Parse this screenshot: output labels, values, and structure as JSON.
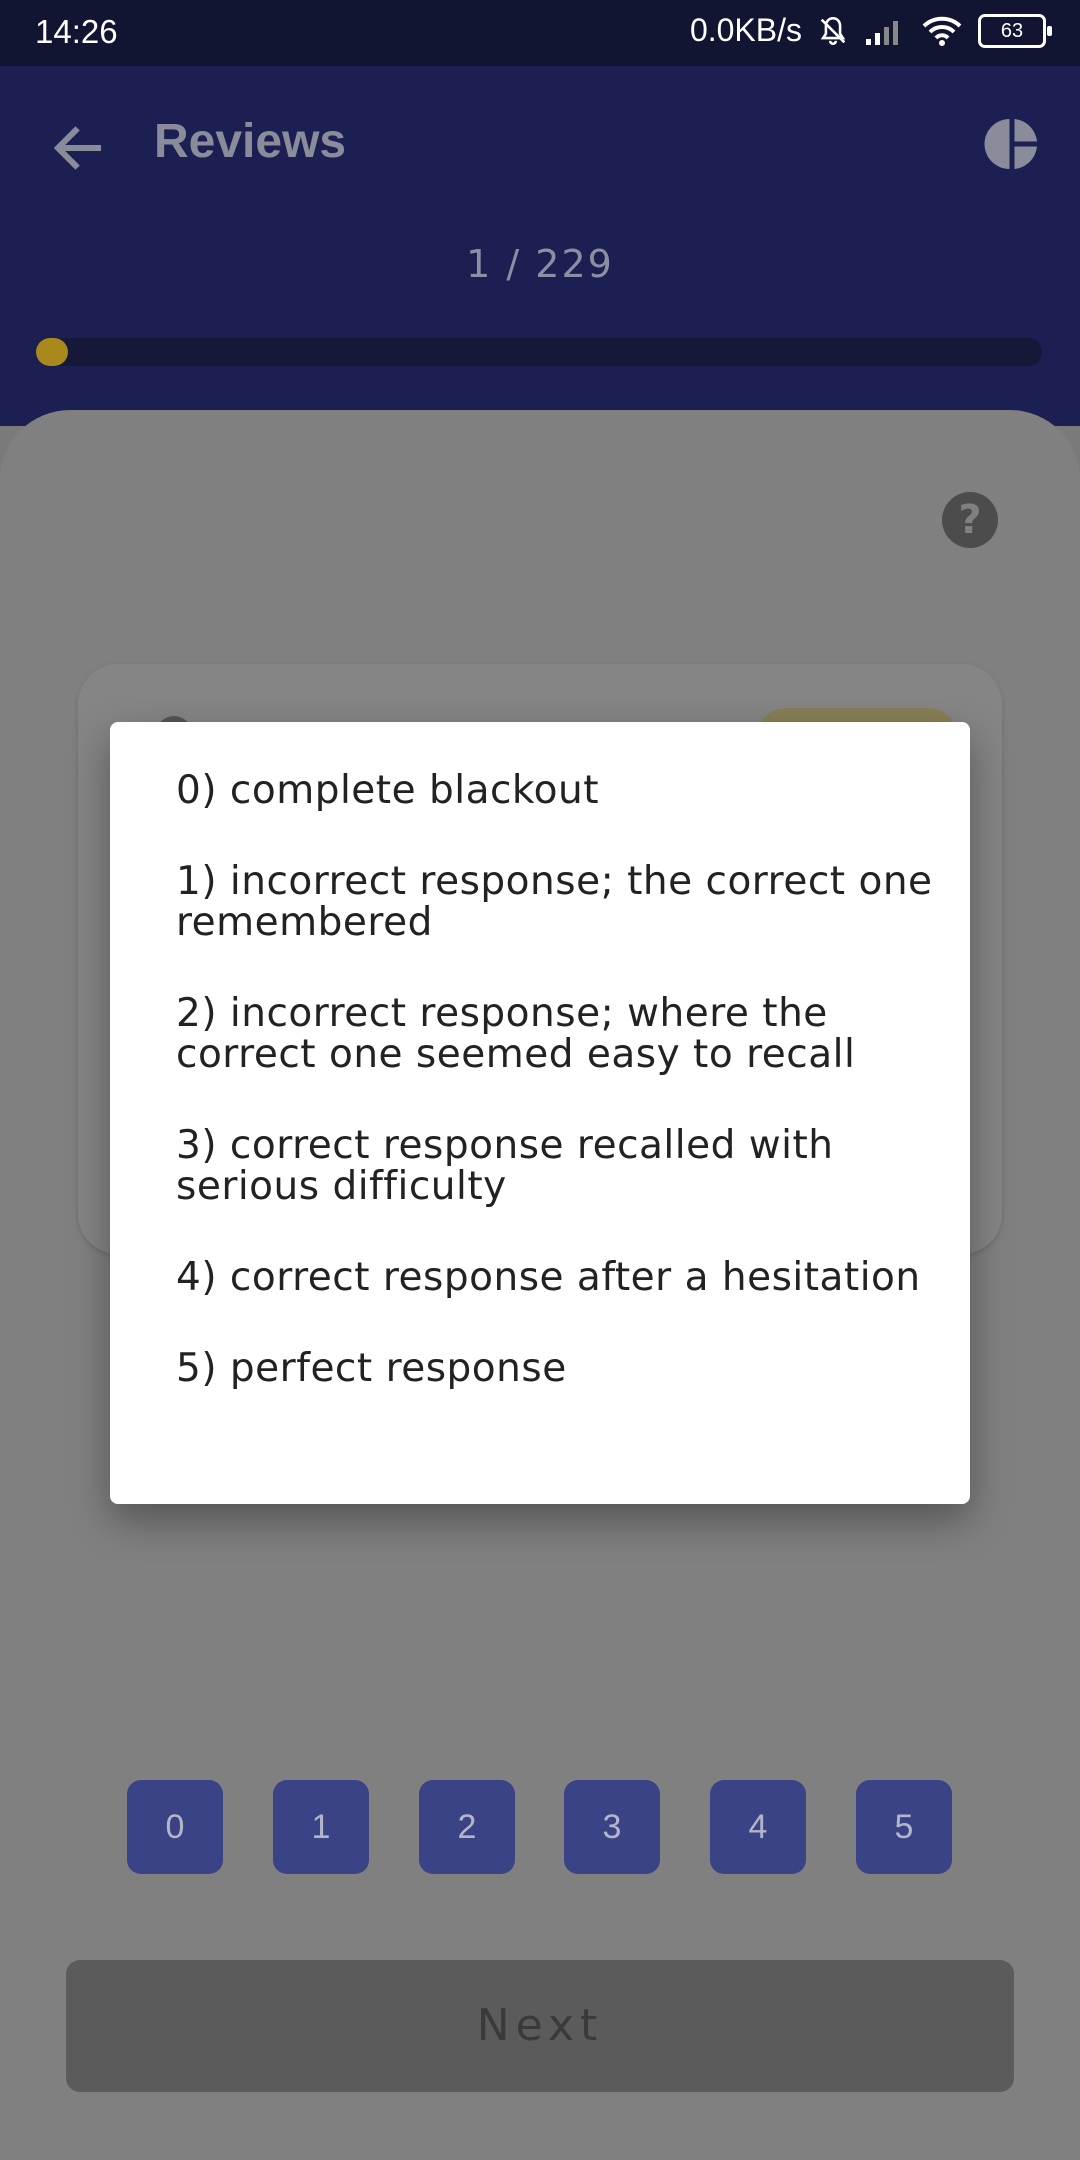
{
  "status_bar": {
    "time": "14:26",
    "speed": "0.0KB/s",
    "battery": "63"
  },
  "header": {
    "title": "Reviews",
    "counter": "1 / 229",
    "progress_fraction": 0.004
  },
  "rating_buttons": [
    "0",
    "1",
    "2",
    "3",
    "4",
    "5"
  ],
  "next_label": "Next",
  "dialog": {
    "items": [
      "0) complete blackout",
      "1) incorrect response; the correct one remembered",
      "2) incorrect response; where the correct one seemed easy to recall",
      "3) correct response recalled with serious difficulty",
      "4) correct response after a hesitation",
      "5) perfect response"
    ]
  },
  "colors": {
    "header_bg": "#1b1f52",
    "progress_accent": "#a9891b",
    "button_bg": "#3a4386"
  }
}
